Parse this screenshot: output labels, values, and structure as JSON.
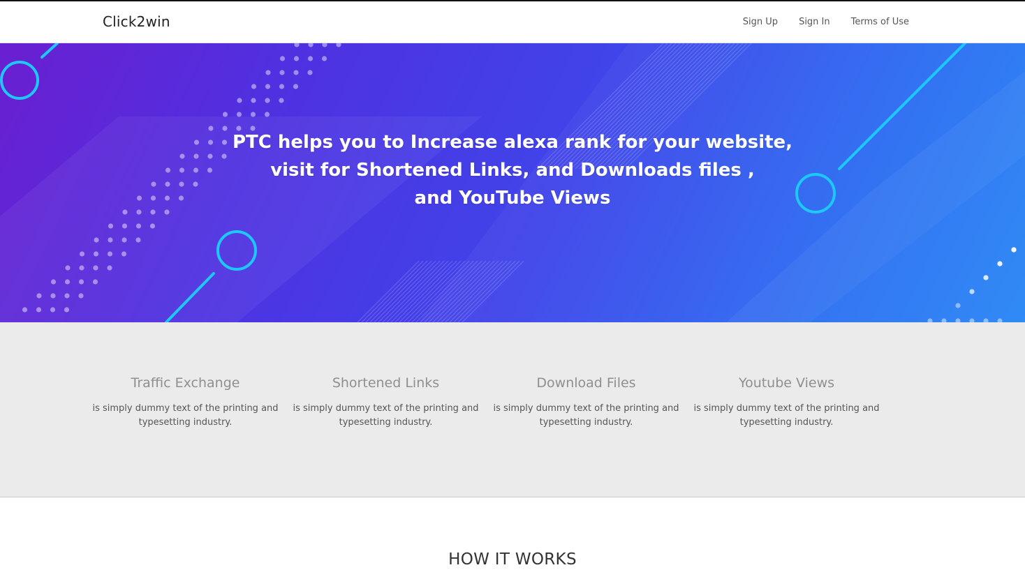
{
  "nav": {
    "brand": "Click2win",
    "links": [
      "Sign Up",
      "Sign In",
      "Terms of Use"
    ]
  },
  "hero": {
    "lines": [
      "PTC helps you to Increase alexa rank for your website,",
      "visit for Shortened Links, and Downloads files ,",
      "and YouTube Views"
    ]
  },
  "features": [
    {
      "title": "Traffic Exchange",
      "text": "is simply dummy text of the printing and typesetting industry."
    },
    {
      "title": "Shortened Links",
      "text": "is simply dummy text of the printing and typesetting industry."
    },
    {
      "title": "Download Files",
      "text": "is simply dummy text of the printing and typesetting industry."
    },
    {
      "title": "Youtube Views",
      "text": "is simply dummy text of the printing and typesetting industry."
    }
  ],
  "how": {
    "title": "HOW IT WORKS"
  },
  "colors": {
    "accent_cyan": "#1ec8ff",
    "hero_start": "#6a1fd0",
    "hero_end": "#2585f5"
  }
}
